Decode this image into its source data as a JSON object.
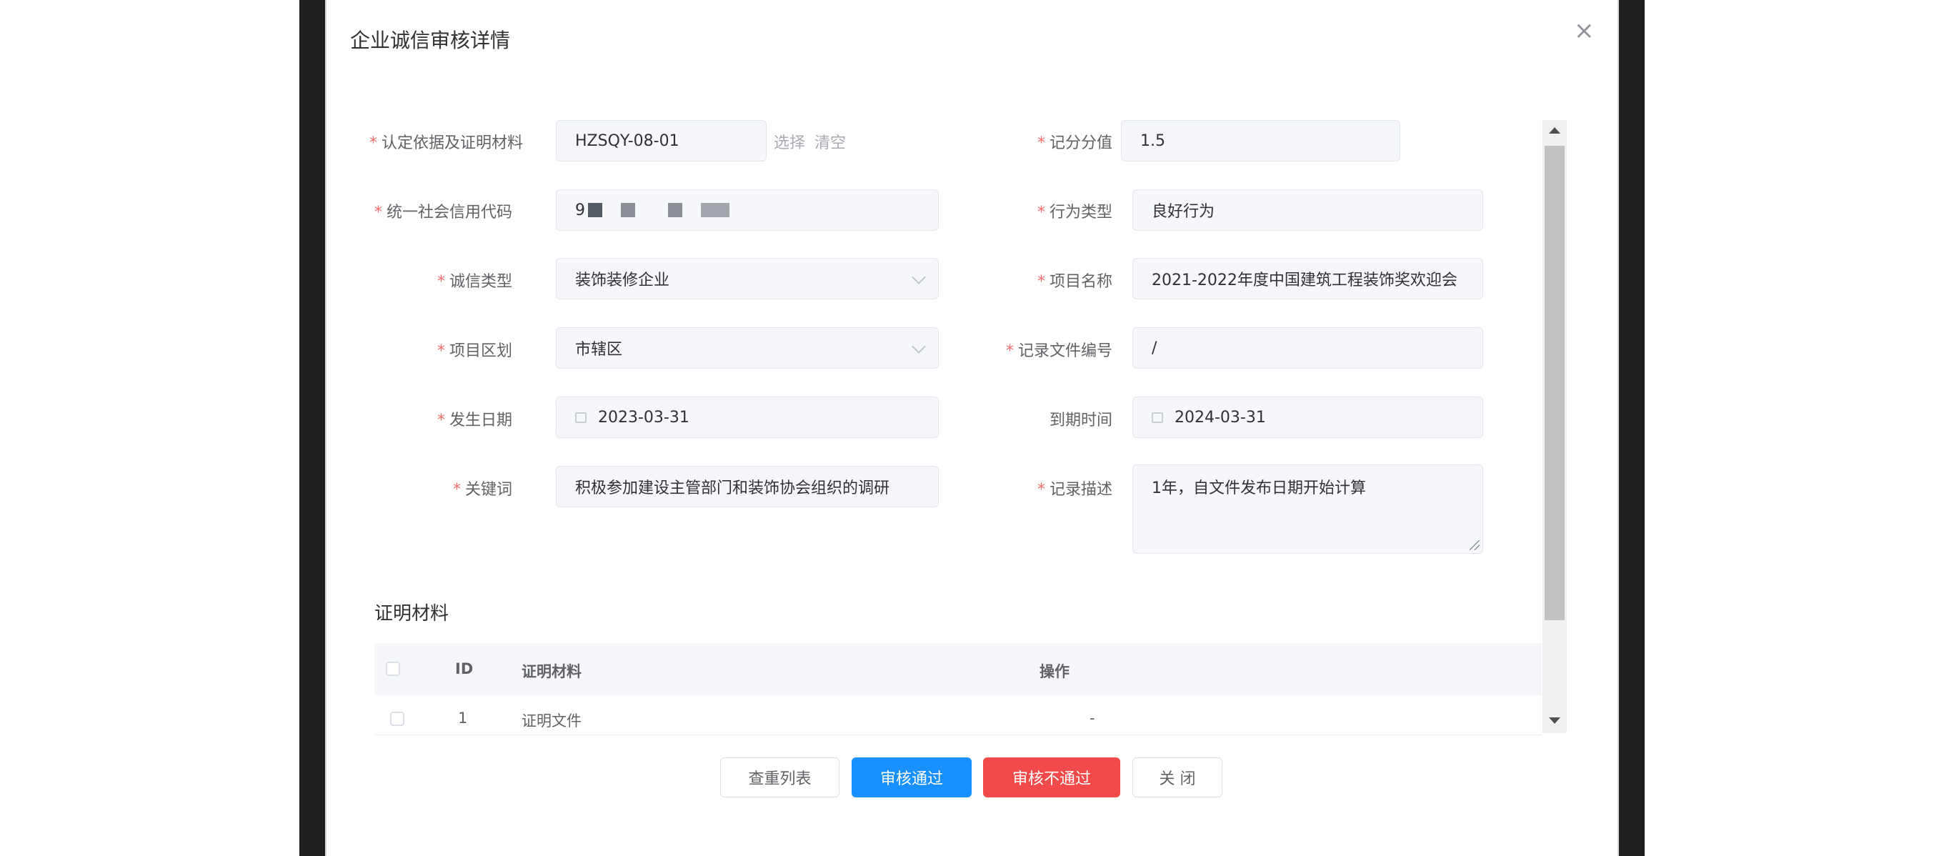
{
  "dialog": {
    "title": "企业诚信审核详情",
    "close_icon": "×"
  },
  "form": {
    "basis": {
      "label": "认定依据及证明材料",
      "value": "HZSQY-08-01",
      "select_label": "选择",
      "clear_label": "清空"
    },
    "score": {
      "label": "记分分值",
      "value": "1.5"
    },
    "credit_code": {
      "label": "统一社会信用代码",
      "value_prefix": "9"
    },
    "behavior_type": {
      "label": "行为类型",
      "value": "良好行为"
    },
    "credit_type": {
      "label": "诚信类型",
      "value": "装饰装修企业"
    },
    "project_name": {
      "label": "项目名称",
      "value": "2021-2022年度中国建筑工程装饰奖欢迎会"
    },
    "district": {
      "label": "项目区划",
      "value": "市辖区"
    },
    "record_file_no": {
      "label": "记录文件编号",
      "value": "/"
    },
    "occur_date": {
      "label": "发生日期",
      "value": "2023-03-31"
    },
    "expire_date": {
      "label": "到期时间",
      "value": "2024-03-31"
    },
    "keyword": {
      "label": "关键词",
      "value": "积极参加建设主管部门和装饰协会组织的调研"
    },
    "record_desc": {
      "label": "记录描述",
      "value": "1年，自文件发布日期开始计算"
    }
  },
  "materials": {
    "title": "证明材料",
    "columns": [
      "ID",
      "证明材料",
      "操作"
    ],
    "rows": [
      {
        "id": "1",
        "name": "证明文件",
        "action": "-"
      }
    ]
  },
  "footer": {
    "dup_list": "查重列表",
    "approve": "审核通过",
    "reject": "审核不通过",
    "close": "关 闭"
  },
  "colors": {
    "primary": "#1890ff",
    "danger": "#f24a4a",
    "required": "#f56c6c"
  }
}
